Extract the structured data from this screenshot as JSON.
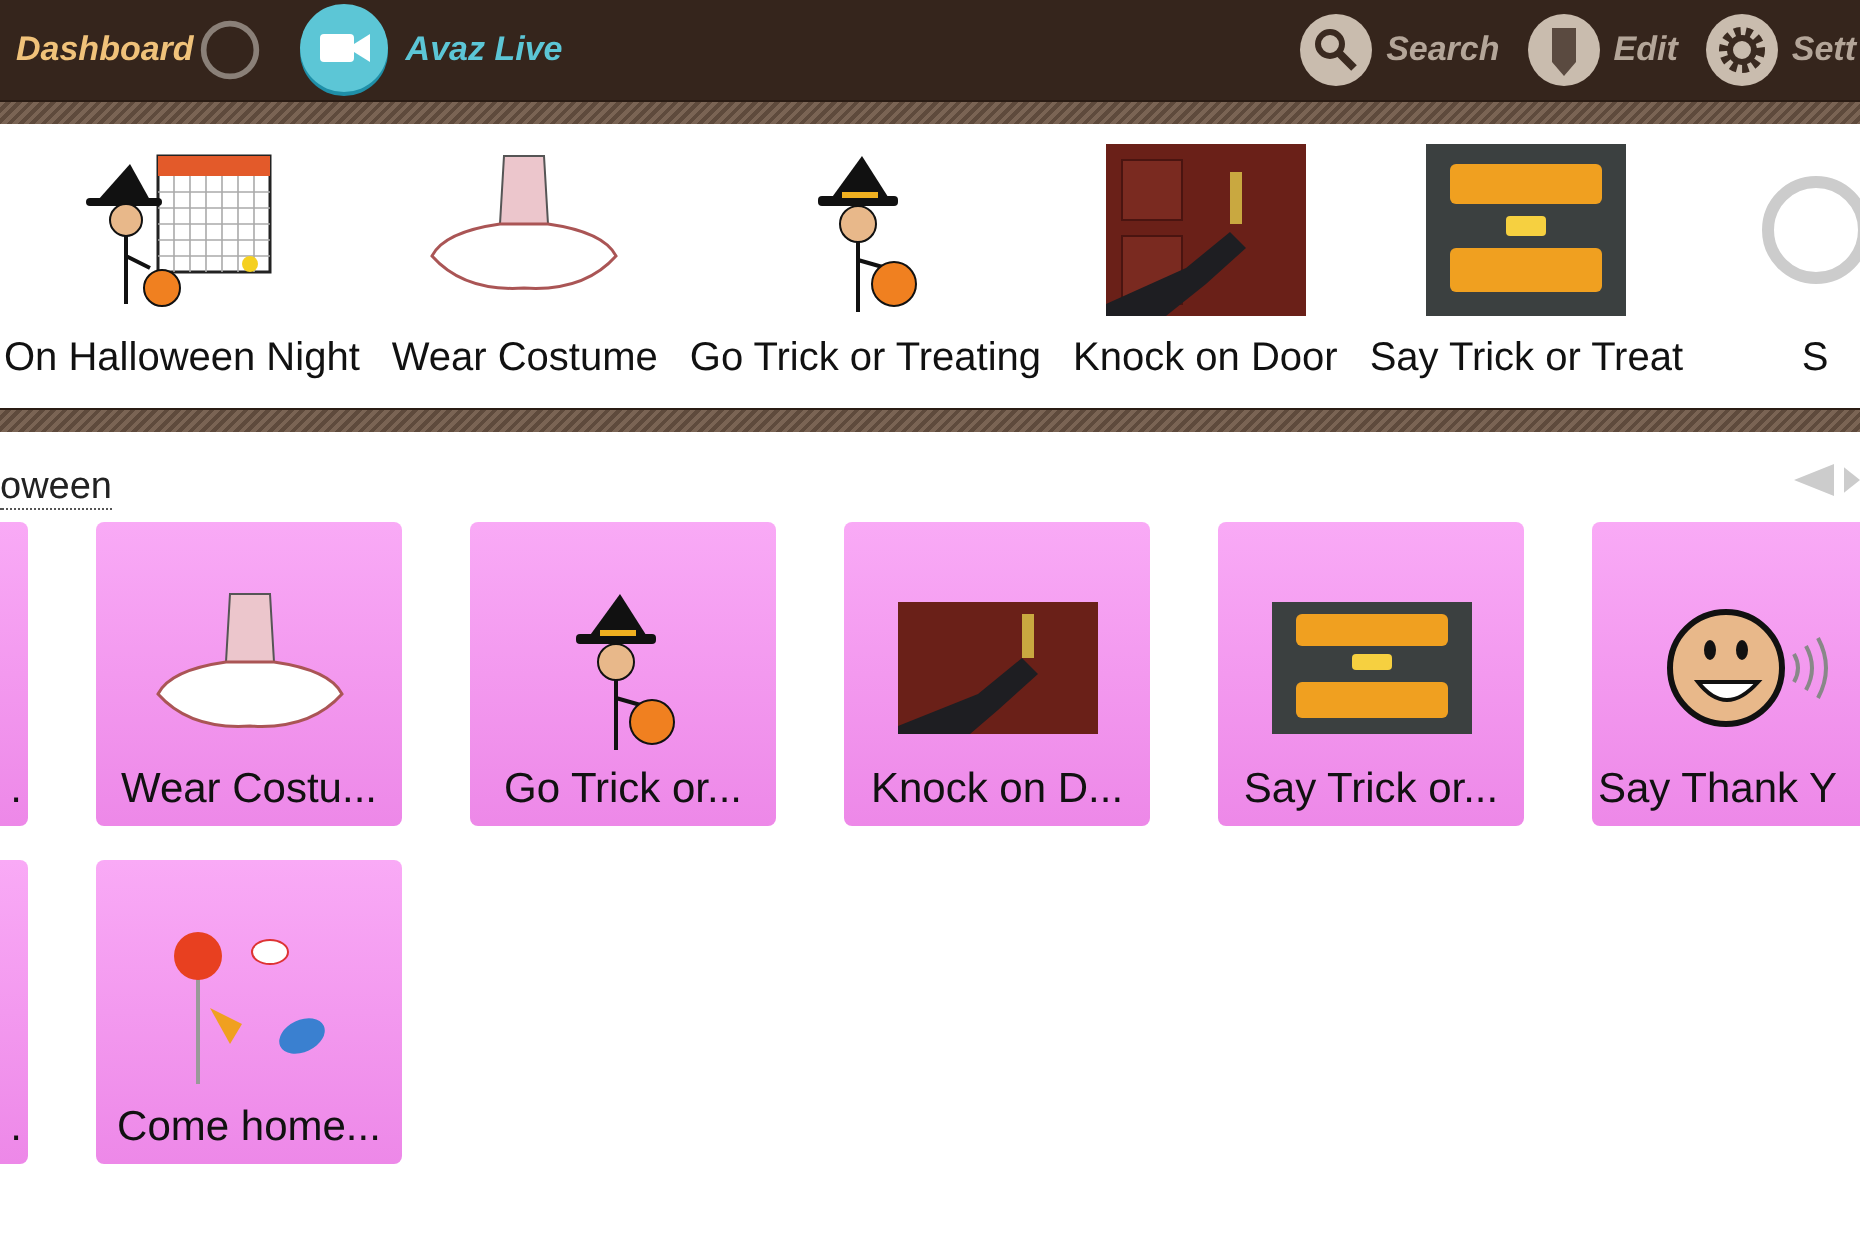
{
  "top_bar": {
    "dashboard": "Dashboard",
    "live_button": {
      "label": "Avaz Live"
    },
    "actions": [
      {
        "kind": "search",
        "label": "Search"
      },
      {
        "kind": "edit",
        "label": "Edit"
      },
      {
        "kind": "settings",
        "label": "Sett"
      }
    ]
  },
  "sentence_strip": [
    {
      "kind": "calendar",
      "label": "On Halloween Night"
    },
    {
      "kind": "dress",
      "label": "Wear Costume"
    },
    {
      "kind": "witch",
      "label": "Go Trick or Treating"
    },
    {
      "kind": "door",
      "label": "Knock on Door"
    },
    {
      "kind": "sign",
      "label": "Say Trick or Treat"
    },
    {
      "kind": "ring",
      "label": "S"
    }
  ],
  "breadcrumb": "oween",
  "tiles": [
    {
      "kind": "none",
      "label": "."
    },
    {
      "kind": "dress",
      "label": "Wear Costu..."
    },
    {
      "kind": "witch",
      "label": "Go Trick or..."
    },
    {
      "kind": "door",
      "label": "Knock on D..."
    },
    {
      "kind": "sign",
      "label": "Say Trick or..."
    },
    {
      "kind": "face",
      "label": "Say Thank Y"
    },
    {
      "kind": "none",
      "label": "."
    },
    {
      "kind": "candy",
      "label": "Come home..."
    }
  ]
}
